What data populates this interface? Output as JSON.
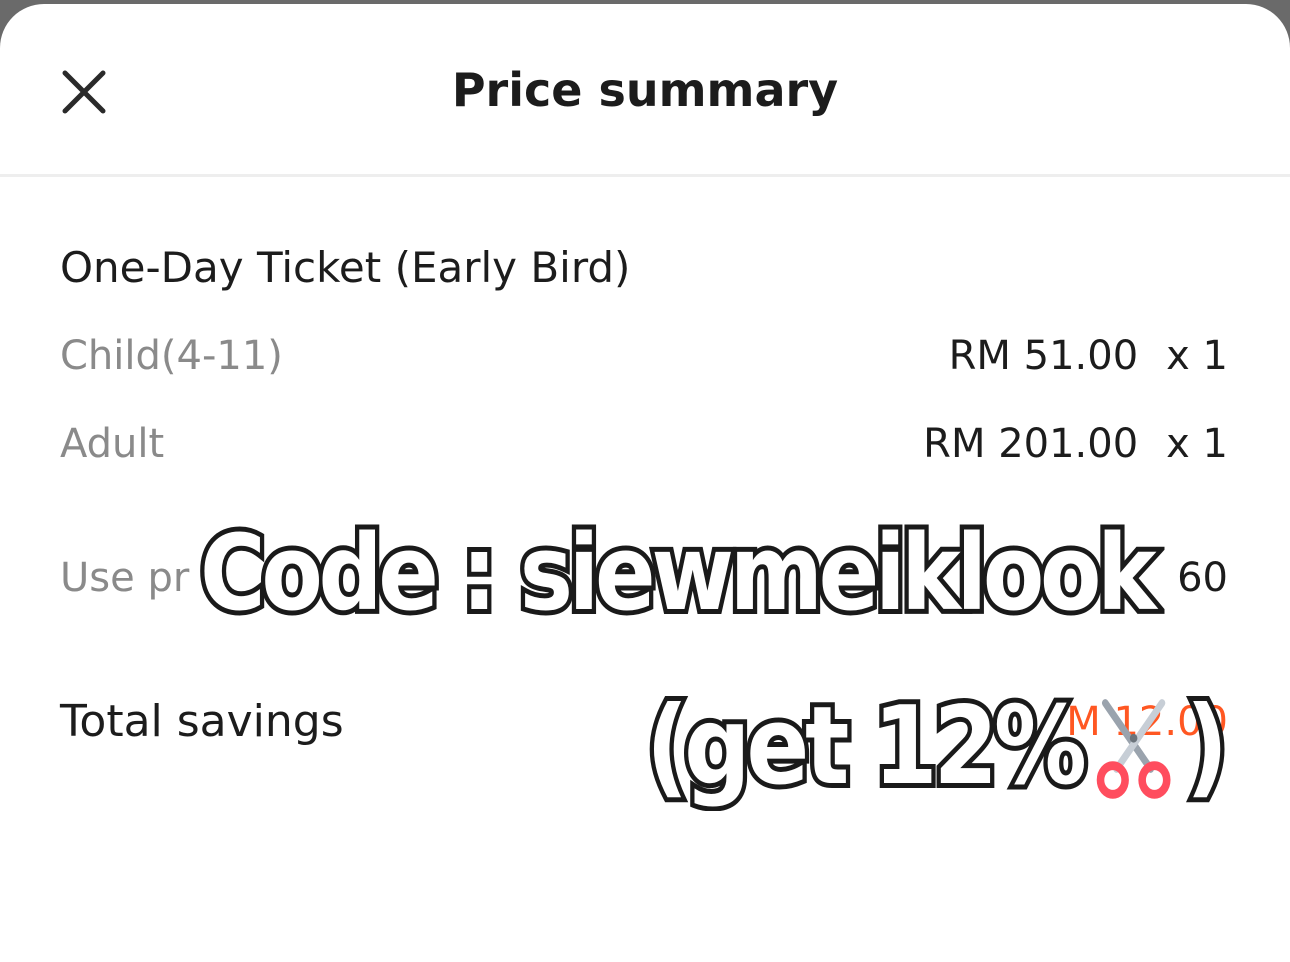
{
  "header": {
    "title": "Price summary",
    "close_icon": "close-icon"
  },
  "ticket": {
    "name": "One-Day Ticket (Early Bird)",
    "lines": [
      {
        "label": "Child(4-11)",
        "price": "RM 51.00",
        "qty": "x 1"
      },
      {
        "label": "Adult",
        "price": "RM 201.00",
        "qty": "x 1"
      }
    ]
  },
  "promo": {
    "label": "Use pr",
    "value": "60"
  },
  "total_savings": {
    "label": "Total savings",
    "value": "M 12.00"
  },
  "overlay": {
    "code_text": "Code : siewmeiklook",
    "discount_text_open": "(get 12%",
    "discount_text_close": ")",
    "discount_icon": "scissors-icon"
  },
  "colors": {
    "accent": "#ff5722",
    "text_primary": "#1c1c1c",
    "text_secondary": "#8a8a8a",
    "divider": "#eeeeee",
    "backdrop": "#6a6a6a"
  }
}
